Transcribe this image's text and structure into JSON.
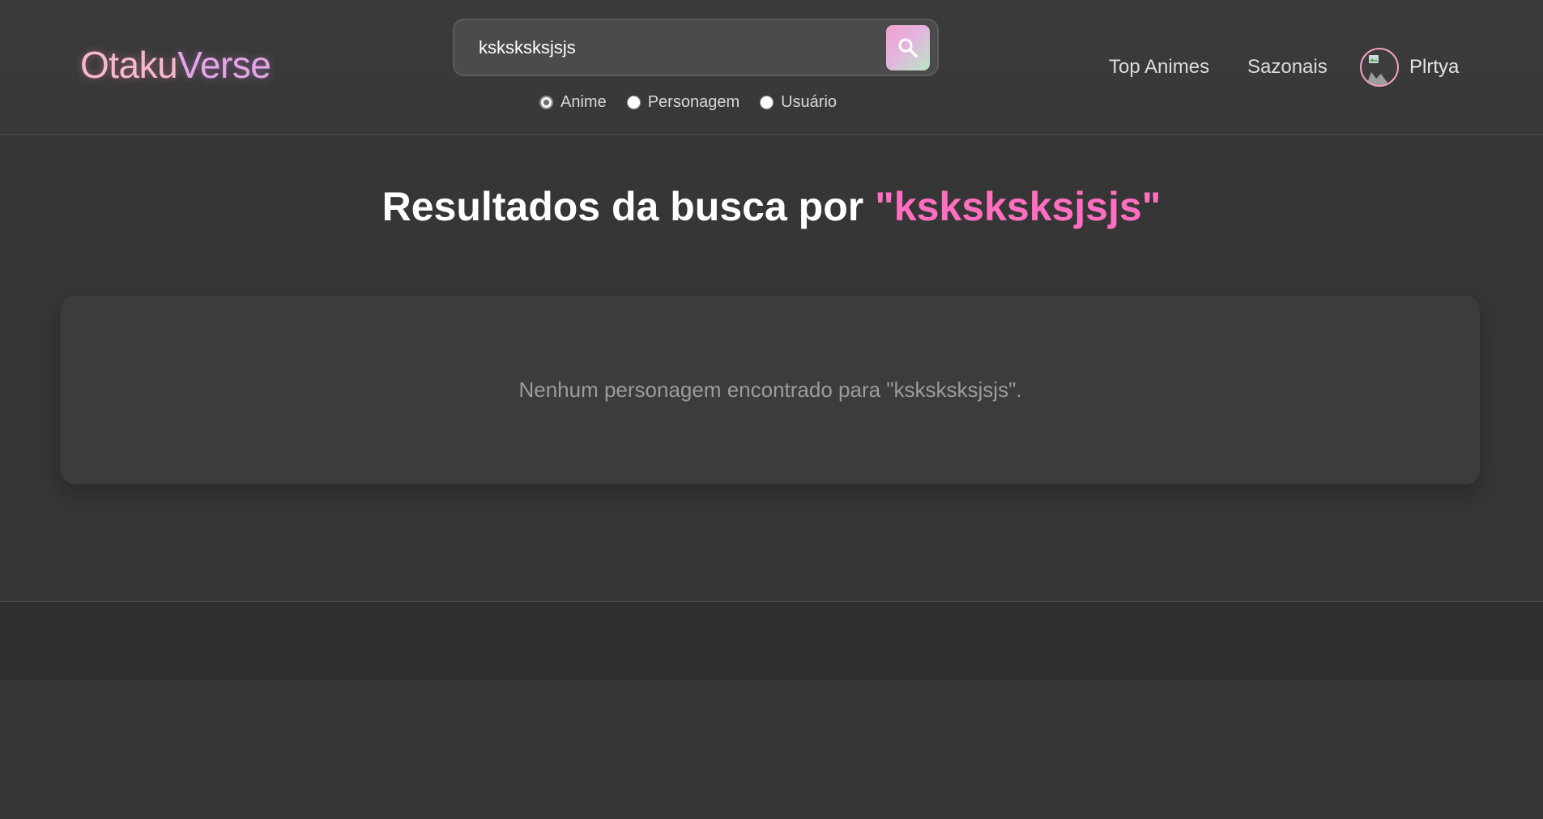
{
  "logo": {
    "part1": "Otaku",
    "part2": "Verse"
  },
  "search": {
    "value": "ksksksksjsjs",
    "placeholder": "",
    "options": [
      {
        "label": "Anime",
        "checked": true
      },
      {
        "label": "Personagem",
        "checked": false
      },
      {
        "label": "Usuário",
        "checked": false
      }
    ]
  },
  "nav": {
    "top_animes": "Top Animes",
    "seasonal": "Sazonais",
    "username": "Plrtya"
  },
  "results": {
    "title_prefix": "Resultados da busca por ",
    "query_display": "\"ksksksksjsjs\"",
    "empty_message": "Nenhum personagem encontrado para \"ksksksksjsjs\"."
  },
  "colors": {
    "accent": "#ff6ec0",
    "avatar_border": "#f1a1bf",
    "background": "#363636"
  }
}
